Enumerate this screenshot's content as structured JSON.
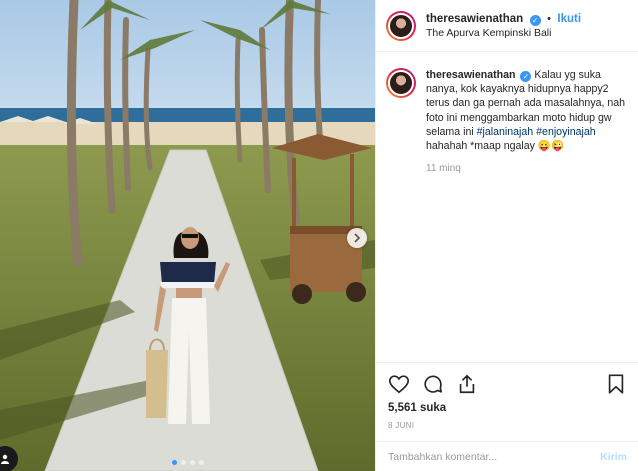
{
  "post": {
    "username": "theresawienathan",
    "verified_icon": "verified-badge-icon",
    "follow_label": "Ikuti",
    "separator": "•",
    "location": "The Apurva Kempinski Bali",
    "caption_parts": [
      "Kalau yg suka nanya, kok kayaknya hidupnya happy2 terus dan ga pernah ada masalahnya, nah foto ini menggambarkan moto hidup gw selama ini ",
      "#jalaninajah",
      " ",
      "#enjoyinajah",
      " hahahah *maap ngalay 😛😜"
    ],
    "time_ago": "11 minq",
    "likes": "5,561 suka",
    "date": "8 JUNI"
  },
  "actions": {
    "like_icon": "heart-icon",
    "comment_icon": "comment-bubble-icon",
    "share_icon": "share-icon",
    "save_icon": "bookmark-icon"
  },
  "comment_box": {
    "placeholder": "Tambahkan komentar...",
    "post_label": "Kirim"
  },
  "carousel": {
    "total_dots": 4,
    "active_index": 0
  },
  "colors": {
    "accent": "#3897f0",
    "hashtag": "#003569",
    "muted": "#999999"
  }
}
